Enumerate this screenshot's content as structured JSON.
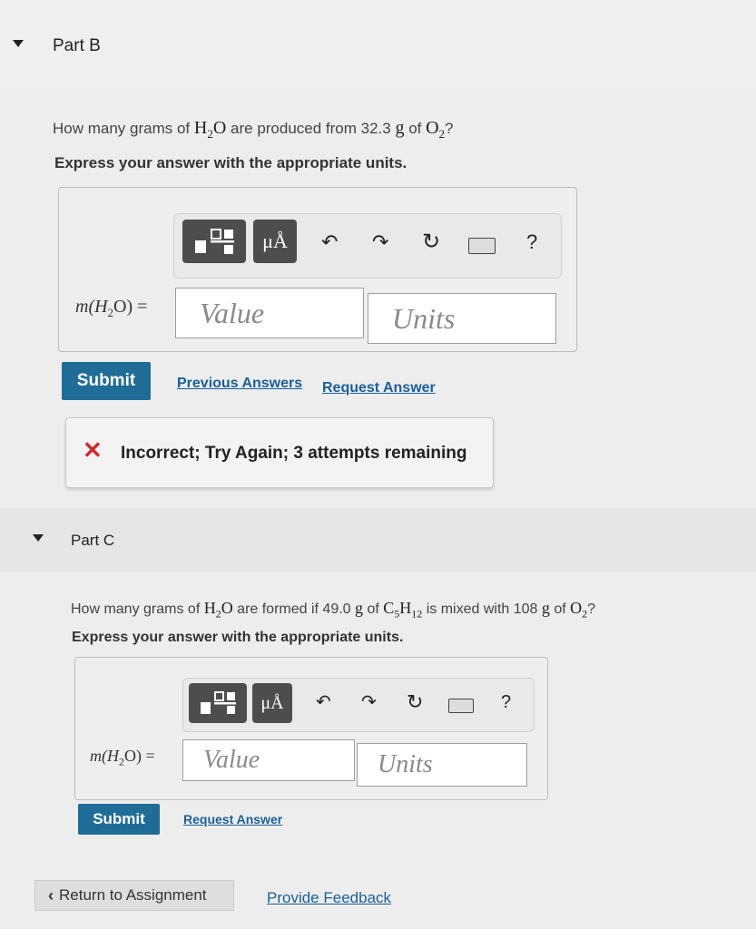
{
  "partB": {
    "title": "Part B",
    "question": {
      "pre": "How many grams of ",
      "species1": "H",
      "species1_sub": "2",
      "species1_tail": "O",
      "mid": " are produced from 32.3 ",
      "unit": "g",
      "of": " of ",
      "species2": "O",
      "species2_sub": "2",
      "end": "?"
    },
    "express": "Express your answer with the appropriate units.",
    "input_label": "m(H",
    "input_label_sub": "2",
    "input_label_tail": "O) =",
    "value_placeholder": "Value",
    "units_placeholder": "Units",
    "submit_label": "Submit",
    "previous_answers_label": "Previous Answers",
    "request_answer_label": "Request Answer",
    "feedback_icon": "✕",
    "feedback_text": "Incorrect; Try Again; 3 attempts remaining"
  },
  "partC": {
    "title": "Part C",
    "question": {
      "pre": "How many grams of ",
      "species1": "H",
      "species1_sub": "2",
      "species1_tail": "O",
      "mid": " are formed if 49.0 ",
      "unit": "g",
      "of": " of ",
      "species2": "C",
      "species2_sub": "5",
      "species2_b": "H",
      "species2_b_sub": "12",
      "mid2": " is mixed with 108 ",
      "unit2": "g",
      "of2": " of ",
      "species3": "O",
      "species3_sub": "2",
      "end": "?"
    },
    "express": "Express your answer with the appropriate units.",
    "input_label": "m(H",
    "input_label_sub": "2",
    "input_label_tail": "O) =",
    "value_placeholder": "Value",
    "units_placeholder": "Units",
    "submit_label": "Submit",
    "request_answer_label": "Request Answer"
  },
  "toolbar": {
    "mu_a_label": "μÅ",
    "help_label": "?"
  },
  "footer": {
    "return_label": "Return to Assignment",
    "feedback_label": "Provide Feedback"
  },
  "colors": {
    "submit": "#1f6d96",
    "link": "#1b5f9a",
    "error": "#d0282e"
  }
}
